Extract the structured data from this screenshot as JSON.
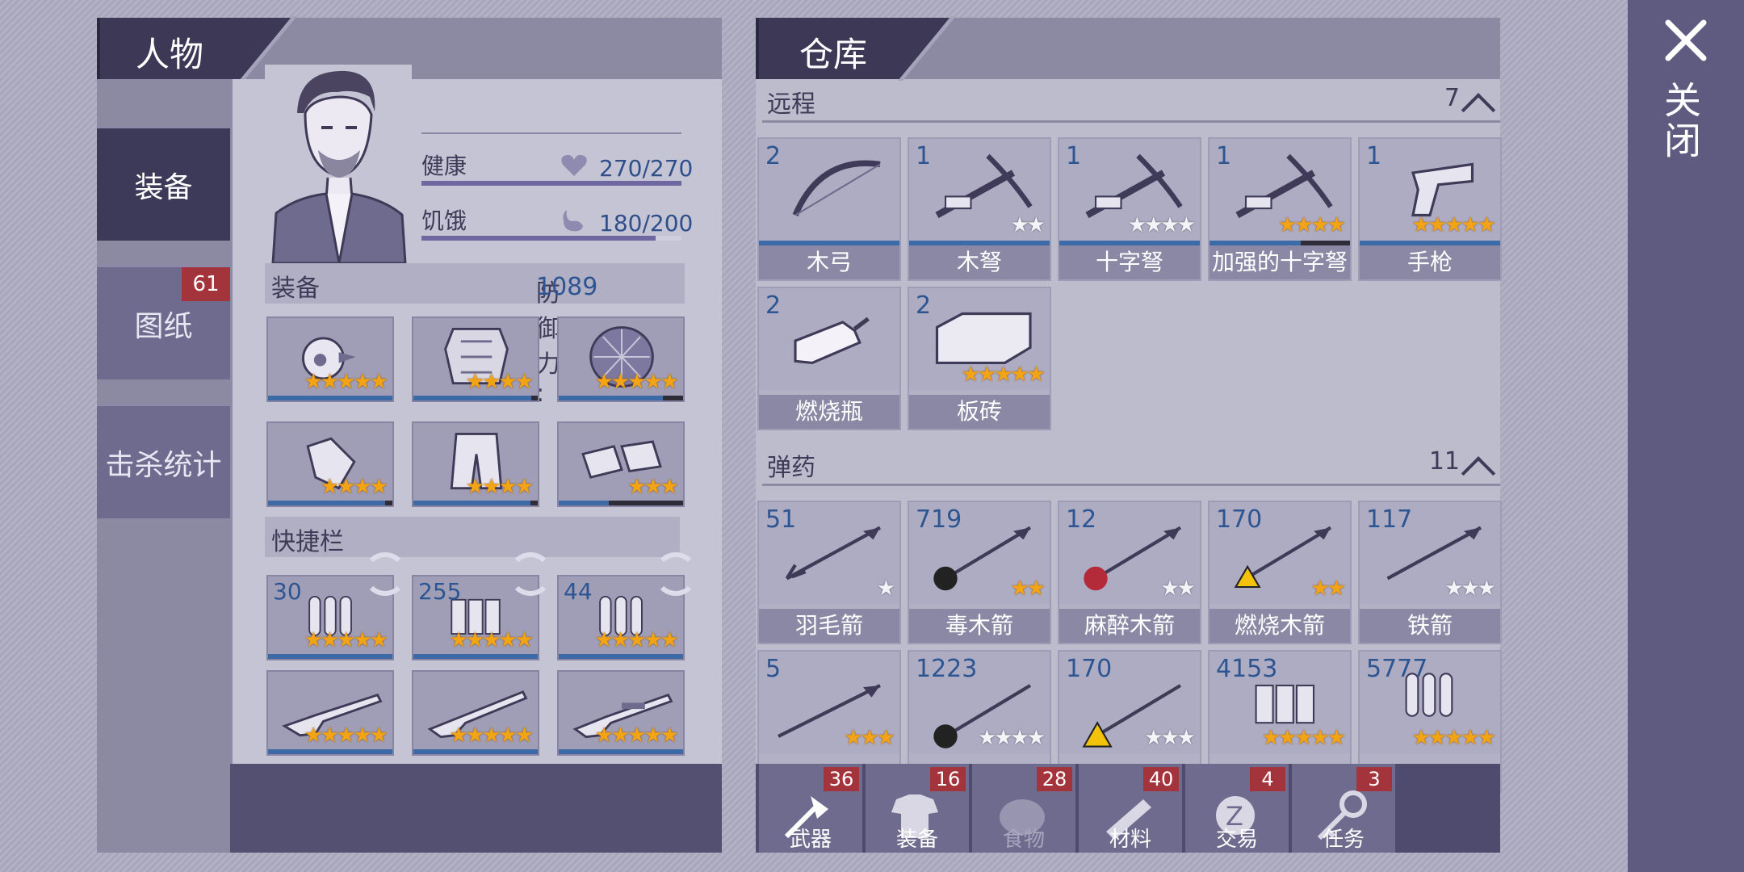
{
  "close_label": "关闭",
  "left_panel": {
    "title": "人物",
    "nav": [
      {
        "label": "装备",
        "active": true
      },
      {
        "label": "图纸",
        "badge": "61"
      },
      {
        "label": "击杀统计"
      }
    ],
    "stats": {
      "health_label": "健康",
      "health_value": "270/270",
      "health_fraction": 1.0,
      "hunger_label": "饥饿",
      "hunger_value": "180/200",
      "hunger_fraction": 0.9
    },
    "equipment_title": "装备",
    "defense_label": "防御力 :",
    "defense_value": "1089",
    "equipment": [
      {
        "icon": "hat-icon",
        "stars": 5,
        "empty": 0,
        "dur": 1.0
      },
      {
        "icon": "armor-icon",
        "stars": 4,
        "empty": 0,
        "dur": 0.95
      },
      {
        "icon": "turtle-shell-icon",
        "stars": 5,
        "empty": 0,
        "dur": 0.84
      },
      {
        "icon": "gloves-icon",
        "stars": 4,
        "empty": 0,
        "dur": 0.94
      },
      {
        "icon": "pants-icon",
        "stars": 4,
        "empty": 0,
        "dur": 0.94
      },
      {
        "icon": "shoes-icon",
        "stars": 3,
        "empty": 0,
        "dur": 0.4
      }
    ],
    "quickbar_title": "快捷栏",
    "quickbar": [
      {
        "count": "30",
        "icon": "bullets-icon",
        "stars": 5
      },
      {
        "count": "255",
        "icon": "shotgun-shells-icon",
        "stars": 5
      },
      {
        "count": "44",
        "icon": "rifle-rounds-icon",
        "stars": 5
      },
      {
        "count": "",
        "icon": "rifle-icon",
        "stars": 5
      },
      {
        "count": "",
        "icon": "shotgun-icon",
        "stars": 5
      },
      {
        "count": "",
        "icon": "sniper-icon",
        "stars": 5
      }
    ]
  },
  "right_panel": {
    "title": "仓库",
    "ranged": {
      "label": "远程",
      "count": "7",
      "items": [
        {
          "count": "2",
          "name": "木弓",
          "stars": 0,
          "empty": 0,
          "dur": 1.0,
          "icon": "bow-icon"
        },
        {
          "count": "1",
          "name": "木弩",
          "stars": 0,
          "empty": 2,
          "dur": 1.0,
          "icon": "crossbow-icon"
        },
        {
          "count": "1",
          "name": "十字弩",
          "stars": 0,
          "empty": 4,
          "dur": 1.0,
          "icon": "crossbow-icon"
        },
        {
          "count": "1",
          "name": "加强的十字弩",
          "stars": 4,
          "empty": 0,
          "dur": 0.65,
          "icon": "crossbow-icon"
        },
        {
          "count": "1",
          "name": "手枪",
          "stars": 5,
          "empty": 0,
          "dur": 1.0,
          "icon": "revolver-icon"
        },
        {
          "count": "2",
          "name": "燃烧瓶",
          "stars": 0,
          "empty": 0,
          "dur": 0,
          "icon": "molotov-icon"
        },
        {
          "count": "2",
          "name": "板砖",
          "stars": 5,
          "empty": 0,
          "dur": 0,
          "icon": "brick-icon"
        }
      ]
    },
    "ammo": {
      "label": "弹药",
      "count": "11",
      "items": [
        {
          "count": "51",
          "name": "羽毛箭",
          "stars": 0,
          "empty": 1,
          "icon": "arrow-icon"
        },
        {
          "count": "719",
          "name": "毒木箭",
          "stars": 2,
          "empty": 0,
          "icon": "poison-arrow-icon"
        },
        {
          "count": "12",
          "name": "麻醉木箭",
          "stars": 0,
          "empty": 2,
          "icon": "tranq-arrow-icon"
        },
        {
          "count": "170",
          "name": "燃烧木箭",
          "stars": 2,
          "empty": 0,
          "icon": "fire-arrow-icon"
        },
        {
          "count": "117",
          "name": "铁箭",
          "stars": 0,
          "empty": 3,
          "icon": "iron-arrow-icon"
        },
        {
          "count": "5",
          "name": "",
          "stars": 3,
          "empty": 0,
          "icon": "bolt-icon"
        },
        {
          "count": "1223",
          "name": "",
          "stars": 0,
          "empty": 4,
          "icon": "poison-bolt-icon"
        },
        {
          "count": "170",
          "name": "",
          "stars": 0,
          "empty": 3,
          "icon": "fire-bolt-icon"
        },
        {
          "count": "4153",
          "name": "",
          "stars": 5,
          "empty": 0,
          "icon": "shells-icon"
        },
        {
          "count": "5777",
          "name": "",
          "stars": 5,
          "empty": 0,
          "icon": "bullets-icon"
        }
      ]
    },
    "tabs": [
      {
        "label": "武器",
        "badge": "36",
        "icon": "axe-icon"
      },
      {
        "label": "装备",
        "badge": "16",
        "icon": "shirt-icon"
      },
      {
        "label": "食物",
        "badge": "28",
        "icon": "meat-icon",
        "dim": true
      },
      {
        "label": "材料",
        "badge": "40",
        "icon": "logs-icon"
      },
      {
        "label": "交易",
        "badge": "4",
        "icon": "coin-icon"
      },
      {
        "label": "任务",
        "badge": "3",
        "icon": "key-icon"
      }
    ]
  }
}
